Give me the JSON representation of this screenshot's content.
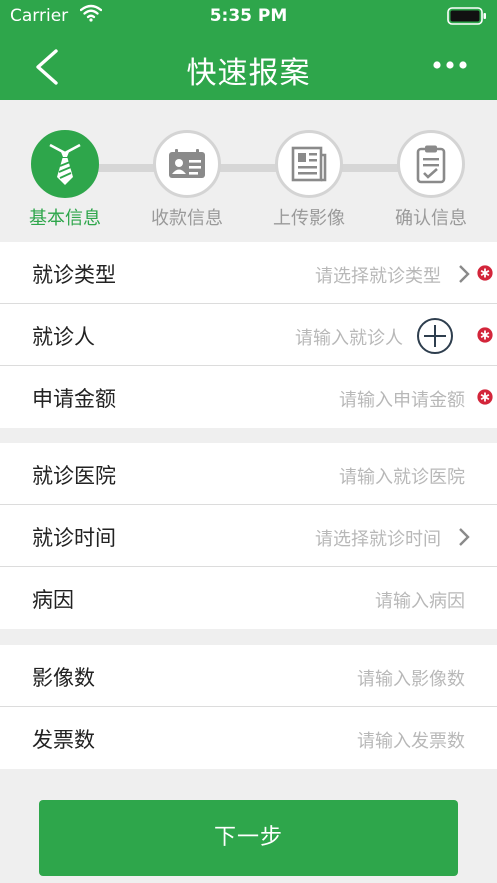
{
  "status_bar": {
    "carrier": "Carrier",
    "time": "5:35 PM"
  },
  "nav": {
    "title": "快速报案",
    "back_icon": "chevron-left-icon",
    "more_icon": "more-dots-icon"
  },
  "steps": [
    {
      "label": "基本信息",
      "icon": "tie-icon",
      "active": true
    },
    {
      "label": "收款信息",
      "icon": "id-card-icon",
      "active": false
    },
    {
      "label": "上传影像",
      "icon": "newspaper-icon",
      "active": false
    },
    {
      "label": "确认信息",
      "icon": "clipboard-icon",
      "active": false
    }
  ],
  "form": {
    "visit_type": {
      "label": "就诊类型",
      "placeholder": "请选择就诊类型"
    },
    "patient": {
      "label": "就诊人",
      "placeholder": "请输入就诊人"
    },
    "amount": {
      "label": "申请金额",
      "placeholder": "请输入申请金额"
    },
    "hospital": {
      "label": "就诊医院",
      "placeholder": "请输入就诊医院"
    },
    "visit_time": {
      "label": "就诊时间",
      "placeholder": "请选择就诊时间"
    },
    "cause": {
      "label": "病因",
      "placeholder": "请输入病因"
    },
    "image_count": {
      "label": "影像数",
      "placeholder": "请输入影像数"
    },
    "invoice_count": {
      "label": "发票数",
      "placeholder": "请输入发票数"
    }
  },
  "next_button": {
    "label": "下一步"
  },
  "colors": {
    "brand": "#2ea64b",
    "required": "#d3253a",
    "divider": "#dcdcdc"
  }
}
